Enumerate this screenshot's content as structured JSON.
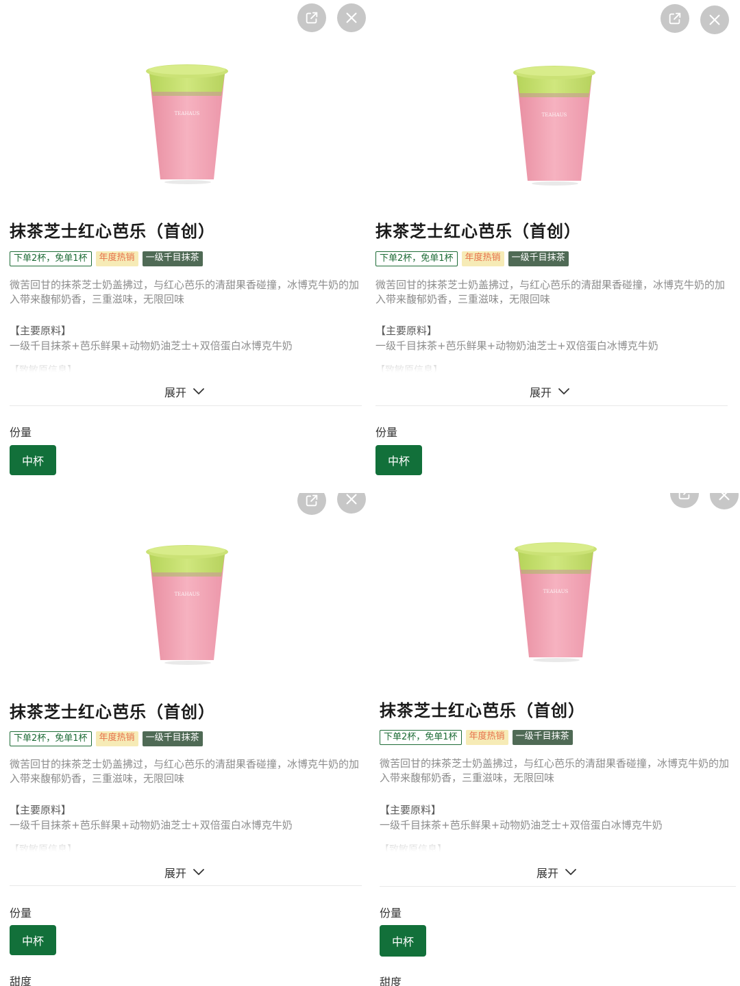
{
  "product": {
    "title": "抹茶芝士红心芭乐（首创）",
    "tags": [
      {
        "label": "下单2杯，免单1杯",
        "style": "outline"
      },
      {
        "label": "年度热销",
        "style": "hot"
      },
      {
        "label": "一级千目抹茶",
        "style": "dark"
      }
    ],
    "description": "微苦回甘的抹茶芝士奶盖拂过，与红心芭乐的清甜果香碰撞，冰博克牛奶的加入带来馥郁奶香，三重滋味，无限回味",
    "ingredients_title": "【主要原料】",
    "ingredients_text": "一级千目抹茶+芭乐鲜果+动物奶油芝士+双倍蛋白冰博克牛奶",
    "faded_line": "【致敏原信息】",
    "expand_label": "展开",
    "size_label": "份量",
    "size_option": "中杯",
    "sweetness_label": "甜度",
    "cup_brand": "TEAHAUS"
  },
  "icons": {
    "share": "share-icon",
    "close": "close-icon",
    "expand": "chevron-down-icon"
  },
  "colors": {
    "accent_green": "#12703a",
    "tag_outline_green": "#1c6b35",
    "cup_pink": "#f4aab8",
    "matcha": "#c6df70"
  }
}
